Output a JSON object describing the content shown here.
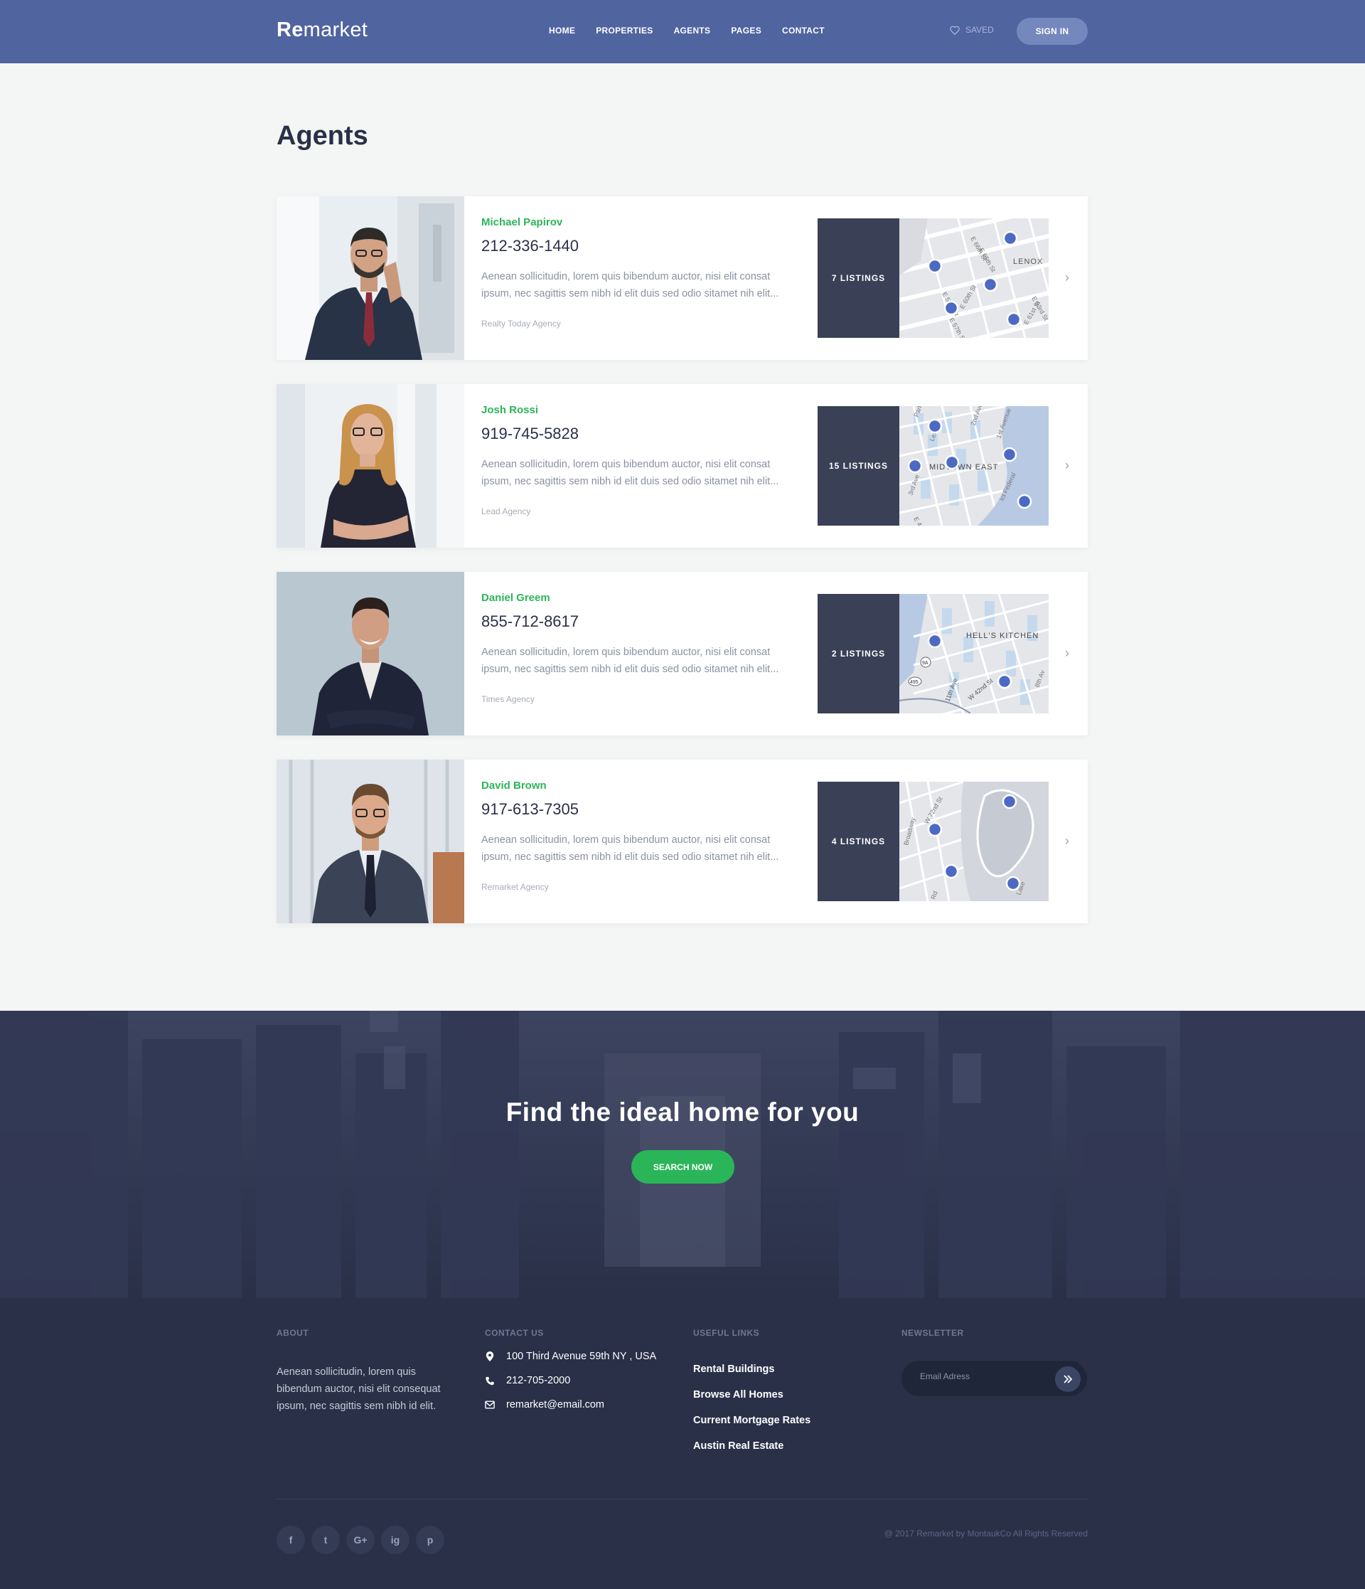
{
  "header": {
    "logo_bold": "Re",
    "logo_rest": "market",
    "nav": [
      "HOME",
      "PROPERTIES",
      "AGENTS",
      "PAGES",
      "CONTACT"
    ],
    "saved_label": "SAVED",
    "signin_label": "SIGN IN"
  },
  "page": {
    "title": "Agents"
  },
  "agents": [
    {
      "name": "Michael Papirov",
      "phone": "212-336-1440",
      "description": "Aenean sollicitudin, lorem quis bibendum auctor, nisi elit consat ipsum, nec sagittis sem nibh id elit duis sed odio sitamet nih elit...",
      "agency": "Realty Today Agency",
      "listings": "7 LISTINGS",
      "map_labels": [
        "LENOX",
        "E 60th St",
        "E 59th St",
        "E 57th St",
        "E 66th St",
        "E 65th St",
        "E 61st St",
        "E 63rd St"
      ]
    },
    {
      "name": "Josh Rossi",
      "phone": "919-745-5828",
      "description": "Aenean sollicitudin, lorem quis bibendum auctor, nisi elit consat ipsum, nec sagittis sem nibh id elit duis sed odio sitamet nih elit...",
      "agency": "Lead Agency",
      "listings": "15 LISTINGS",
      "map_labels": [
        "MIDTOWN EAST",
        "E 42nd St",
        "3rd Ave",
        "2nd Ave",
        "1st Avenue",
        "Park",
        "Lex",
        "Ict Federal"
      ]
    },
    {
      "name": "Daniel Greem",
      "phone": "855-712-8617",
      "description": "Aenean sollicitudin, lorem quis bibendum auctor, nisi elit consat ipsum, nec sagittis sem nibh id elit duis sed odio sitamet nih elit...",
      "agency": "Times Agency",
      "listings": "2 LISTINGS",
      "map_labels": [
        "HELL'S KITCHEN",
        "W 42nd St",
        "11th Ave",
        "9A",
        "495",
        "8th Av"
      ]
    },
    {
      "name": "David Brown",
      "phone": "917-613-7305",
      "description": "Aenean sollicitudin, lorem quis bibendum auctor, nisi elit consat ipsum, nec sagittis sem nibh id elit duis sed odio sitamet nih elit...",
      "agency": "Remarket Agency",
      "listings": "4 LISTINGS",
      "map_labels": [
        "W 72nd St",
        "Broadway",
        "Lake",
        "Rd"
      ]
    }
  ],
  "cta": {
    "title": "Find the ideal home for you",
    "button": "SEARCH NOW"
  },
  "footer": {
    "about_heading": "ABOUT",
    "about_text": "Aenean sollicitudin, lorem quis bibendum auctor, nisi elit consequat ipsum, nec sagittis sem nibh id elit.",
    "contact_heading": "CONTACT US",
    "address": "100 Third Avenue 59th NY , USA",
    "phone": "212-705-2000",
    "email": "remarket@email.com",
    "links_heading": "USEFUL LINKS",
    "links": [
      "Rental Buildings",
      "Browse All Homes",
      "Current Mortgage Rates",
      "Austin Real Estate"
    ],
    "newsletter_heading": "NEWSLETTER",
    "email_placeholder": "Email Adress",
    "socials": [
      "f",
      "t",
      "G+",
      "ig",
      "p"
    ],
    "copyright": "@ 2017 Remarket by MontaukCo All Rights Reserved"
  },
  "colors": {
    "header": "#5064a0",
    "accent_green": "#2cb55a",
    "footer": "#293048",
    "map_pin": "#4c69c3",
    "listing_box": "#3a4056"
  }
}
